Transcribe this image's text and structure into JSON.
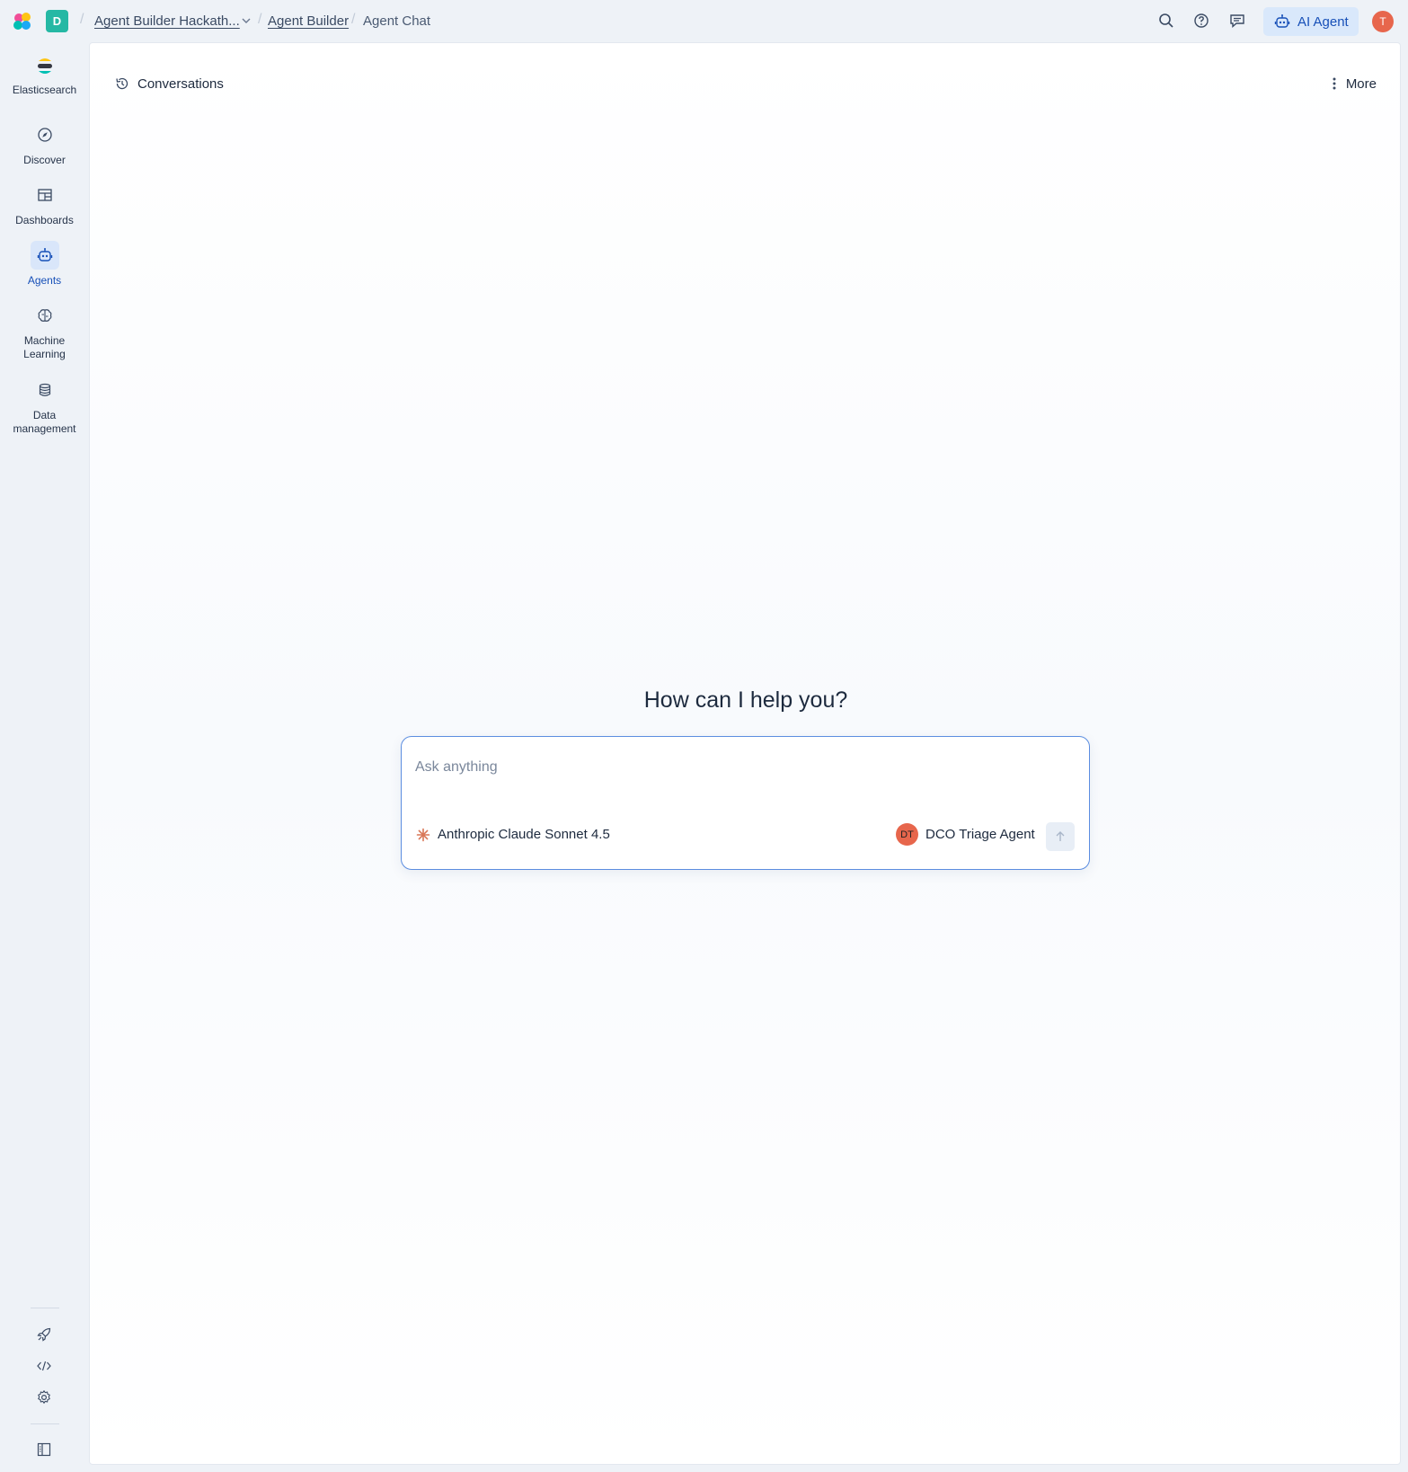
{
  "header": {
    "space_initial": "D",
    "breadcrumbs": [
      {
        "label": "Agent Builder Hackath..."
      },
      {
        "label": "Agent Builder"
      },
      {
        "label": "Agent Chat"
      }
    ],
    "ai_agent_label": "AI Agent",
    "user_initial": "T"
  },
  "sidebar": {
    "brand": "Elasticsearch",
    "items": [
      {
        "label": "Discover",
        "icon": "compass-icon"
      },
      {
        "label": "Dashboards",
        "icon": "dashboard-icon"
      },
      {
        "label": "Agents",
        "icon": "robot-icon",
        "active": true
      },
      {
        "label_line1": "Machine",
        "label_line2": "Learning",
        "icon": "brain-icon"
      },
      {
        "label_line1": "Data",
        "label_line2": "management",
        "icon": "database-icon"
      }
    ],
    "tools": [
      "rocket-icon",
      "code-icon",
      "gear-icon",
      "panel-toggle-icon"
    ]
  },
  "main": {
    "conversations_label": "Conversations",
    "more_label": "More",
    "greeting": "How can I help you?",
    "chat": {
      "placeholder": "Ask anything",
      "value": "",
      "model": "Anthropic Claude Sonnet 4.5",
      "agent_initials": "DT",
      "agent_name": "DCO Triage Agent"
    }
  },
  "colors": {
    "accent": "#1750b8",
    "space_badge": "#25b8a4",
    "avatar": "#e7664c",
    "background": "#eef2f7"
  }
}
